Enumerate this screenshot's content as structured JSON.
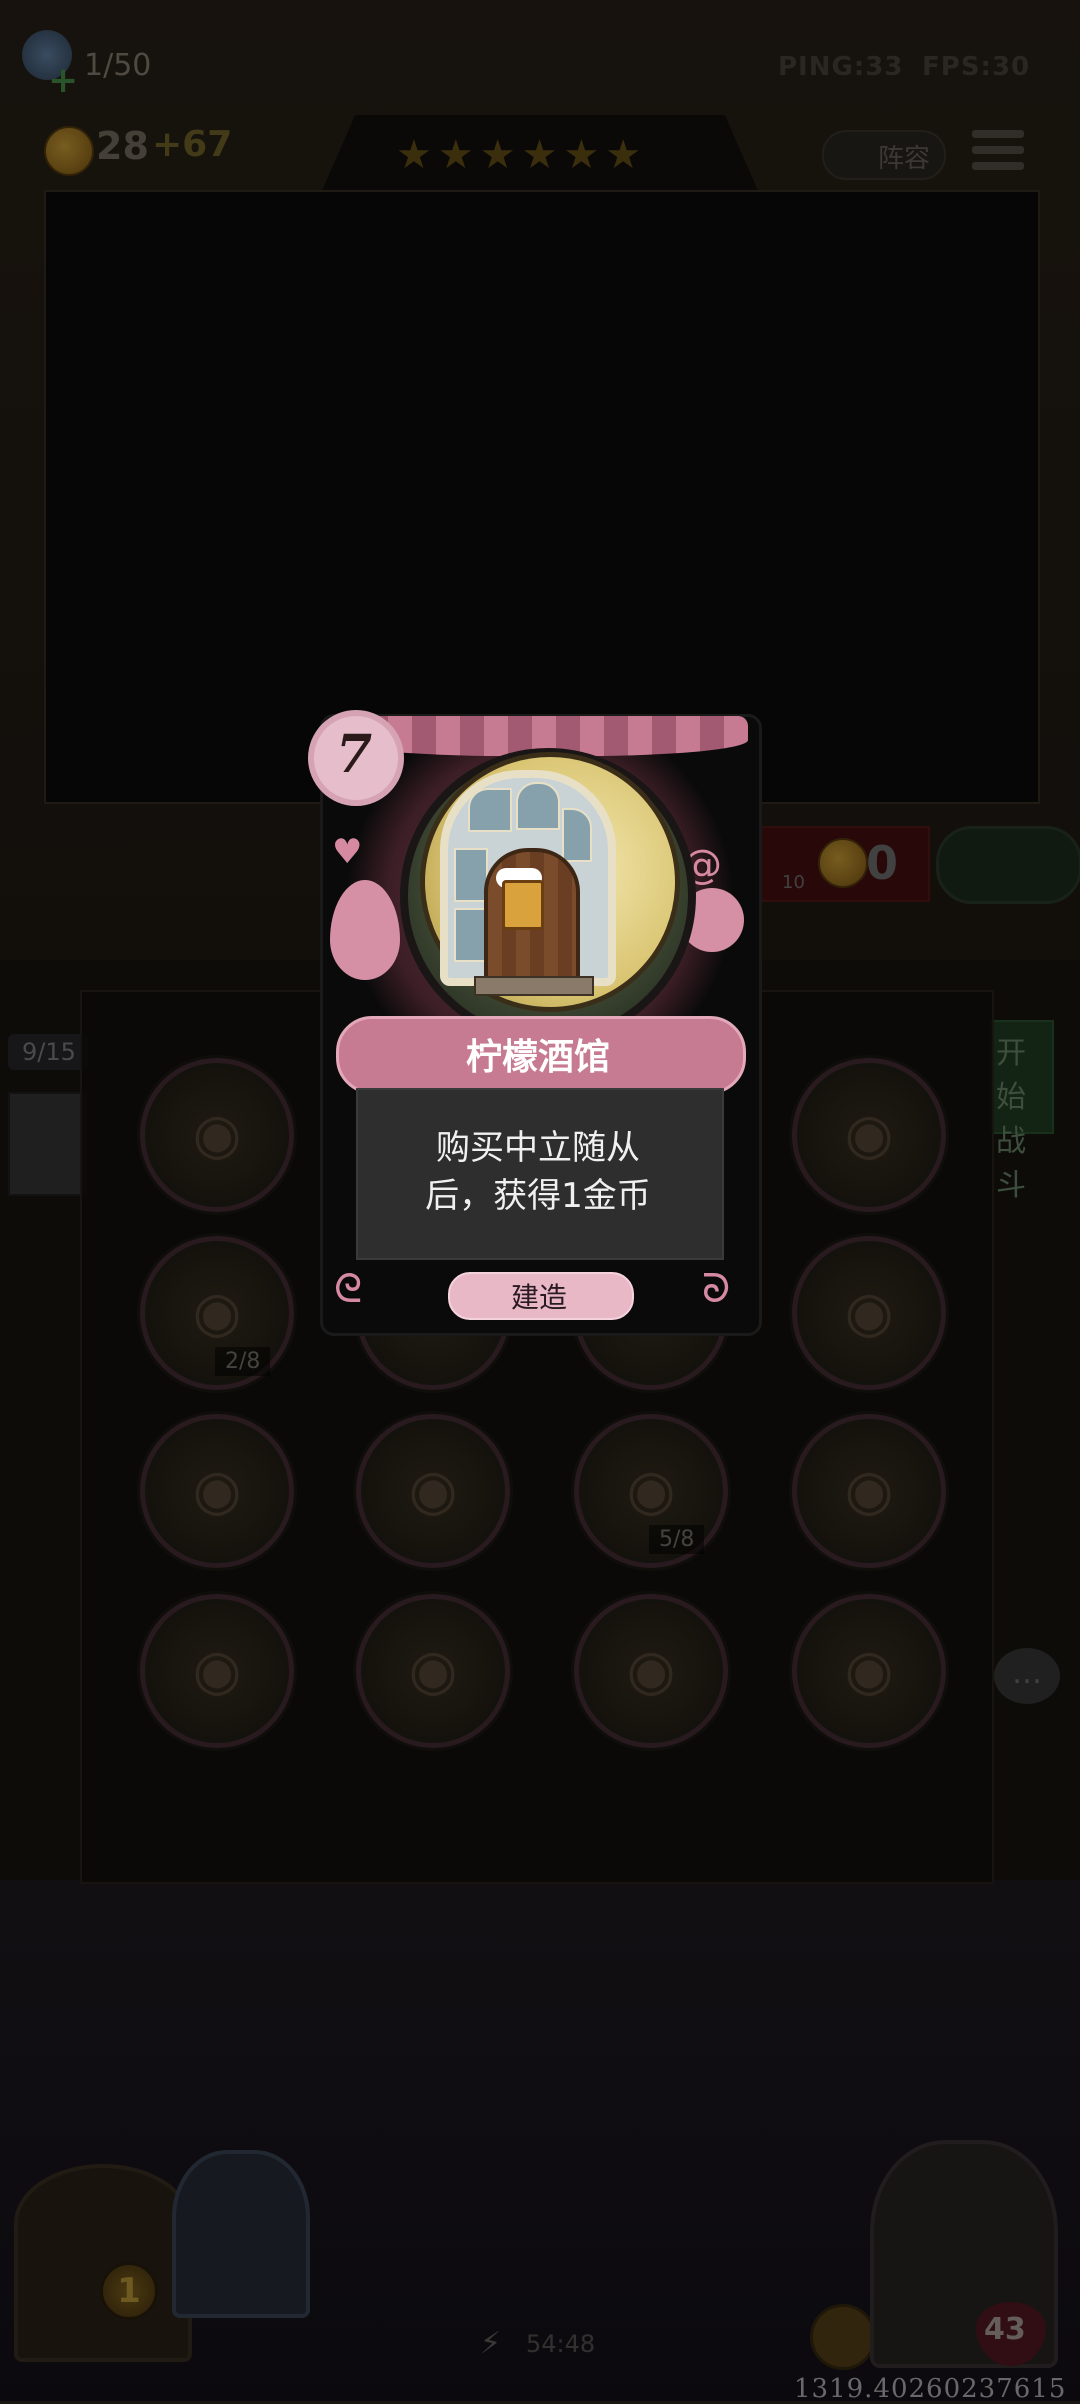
{
  "hud": {
    "population": "1/50",
    "ping": "PING:33",
    "fps": "FPS:30",
    "gold": "28",
    "gold_income": "+67",
    "stars": "★★★★★★",
    "lineup_label": "阵容"
  },
  "controls": {
    "refresh_cost": "10",
    "refresh_value": "0",
    "start_battle": "开始战斗",
    "side_counter": "9/15",
    "chat_icon": "chat-bubble"
  },
  "shop": {
    "slots": [
      {
        "icon": "slot-machine",
        "count": ""
      },
      {
        "icon": "",
        "count": ""
      },
      {
        "icon": "",
        "count": ""
      },
      {
        "icon": "pirate-flag",
        "count": ""
      },
      {
        "icon": "castle",
        "count": "2/8"
      },
      {
        "icon": "",
        "count": ""
      },
      {
        "icon": "",
        "count": ""
      },
      {
        "icon": "pirate-flag",
        "count": ""
      },
      {
        "icon": "lemon-house",
        "count": ""
      },
      {
        "icon": "pizza-stand",
        "count": ""
      },
      {
        "icon": "castle",
        "count": "5/8"
      },
      {
        "icon": "cannon",
        "count": ""
      },
      {
        "icon": "cannon",
        "count": ""
      },
      {
        "icon": "book-stack",
        "count": ""
      },
      {
        "icon": "market-stall",
        "count": ""
      },
      {
        "icon": "market-stall",
        "count": ""
      }
    ]
  },
  "bottom": {
    "level": "1",
    "timer": "54:48",
    "hp": "43",
    "coordinate_readout": "1319.40260237615"
  },
  "card": {
    "cost": "7",
    "name": "柠檬酒馆",
    "description_line1": "购买中立随从",
    "description_line2": "后，获得1金币",
    "build_label": "建造"
  },
  "colors": {
    "card_pink": "#c77b92",
    "card_bg": "#0a0a0a",
    "lemon": "#d9c471"
  }
}
